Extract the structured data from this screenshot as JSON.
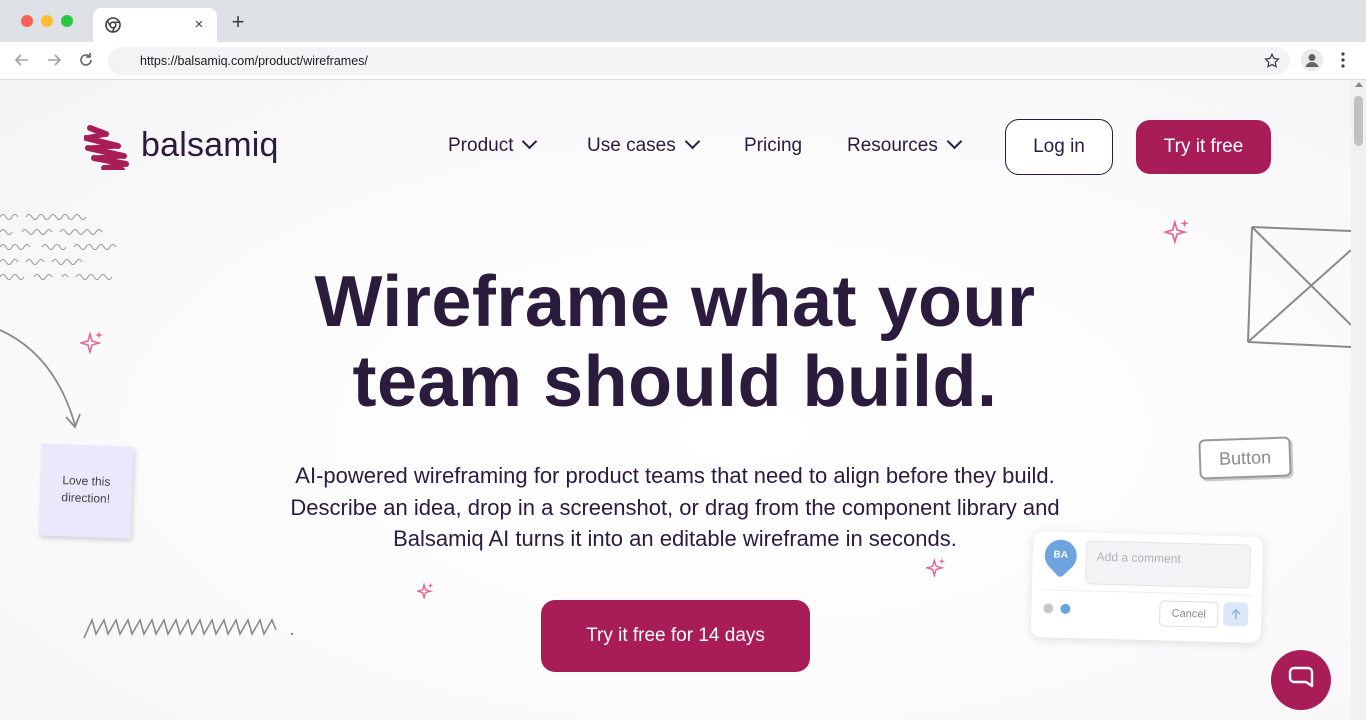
{
  "browser": {
    "url": "https://balsamiq.com/product/wireframes/",
    "tab_close": "×",
    "new_tab": "+"
  },
  "site": {
    "logo_text": "balsamiq",
    "nav": [
      {
        "label": "Product"
      },
      {
        "label": "Use cases"
      },
      {
        "label": "Pricing"
      },
      {
        "label": "Resources"
      }
    ],
    "login_label": "Log in",
    "try_label": "Try it free"
  },
  "hero": {
    "title_line1": "Wireframe what your",
    "title_line2": "team should build.",
    "subtitle_line1": "AI-powered wireframing for product teams that need to align before they build.",
    "subtitle_line2": "Describe an idea, drop in a screenshot, or drag from the component library and",
    "subtitle_line3": "Balsamiq AI turns it into an editable wireframe in seconds.",
    "cta_label": "Try it free for 14 days"
  },
  "decorations": {
    "sticky_note_line1": "Love this",
    "sticky_note_line2": "direction!",
    "sketch_button_label": "Button",
    "comment_avatar": "BA",
    "comment_placeholder": "Add a comment",
    "comment_cancel": "Cancel"
  },
  "colors": {
    "brand": "#a81c58",
    "text_dark": "#2b1b3d",
    "sparkle": "#e06a94",
    "sketch_gray": "#8a8a8a"
  }
}
